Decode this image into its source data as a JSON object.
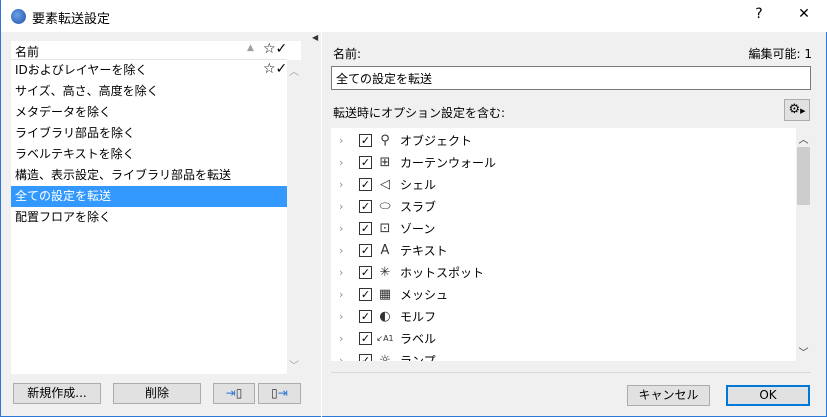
{
  "window": {
    "title": "要素転送設定",
    "help": "?",
    "close": "✕"
  },
  "left": {
    "header": "名前",
    "items": [
      "IDおよびレイヤーを除く",
      "サイズ、高さ、高度を除く",
      "メタデータを除く",
      "ライブラリ部品を除く",
      "ラベルテキストを除く",
      "構造、表示設定、ライブラリ部品を転送",
      "全ての設定を転送",
      "配置フロアを除く"
    ],
    "selected_index": 6,
    "buttons": {
      "new": "新規作成...",
      "delete": "削除",
      "import": "⇥",
      "export": "⇥"
    }
  },
  "right": {
    "name_label": "名前:",
    "editable": "編集可能: 1",
    "name_value": "全ての設定を転送",
    "options_label": "転送時にオプション設定を含む:",
    "tree": [
      {
        "label": "オブジェクト",
        "icon": "⚲"
      },
      {
        "label": "カーテンウォール",
        "icon": "⊞"
      },
      {
        "label": "シェル",
        "icon": "◁"
      },
      {
        "label": "スラブ",
        "icon": "⬭"
      },
      {
        "label": "ゾーン",
        "icon": "⊡"
      },
      {
        "label": "テキスト",
        "icon": "A"
      },
      {
        "label": "ホットスポット",
        "icon": "✳"
      },
      {
        "label": "メッシュ",
        "icon": "▦"
      },
      {
        "label": "モルフ",
        "icon": "◐"
      },
      {
        "label": "ラベル",
        "icon": "↙A1"
      },
      {
        "label": "ランプ",
        "icon": "☼"
      }
    ],
    "cancel": "キャンセル",
    "ok": "OK"
  },
  "colors": {
    "accent": "#3399ff",
    "border": "#2b78d6"
  }
}
